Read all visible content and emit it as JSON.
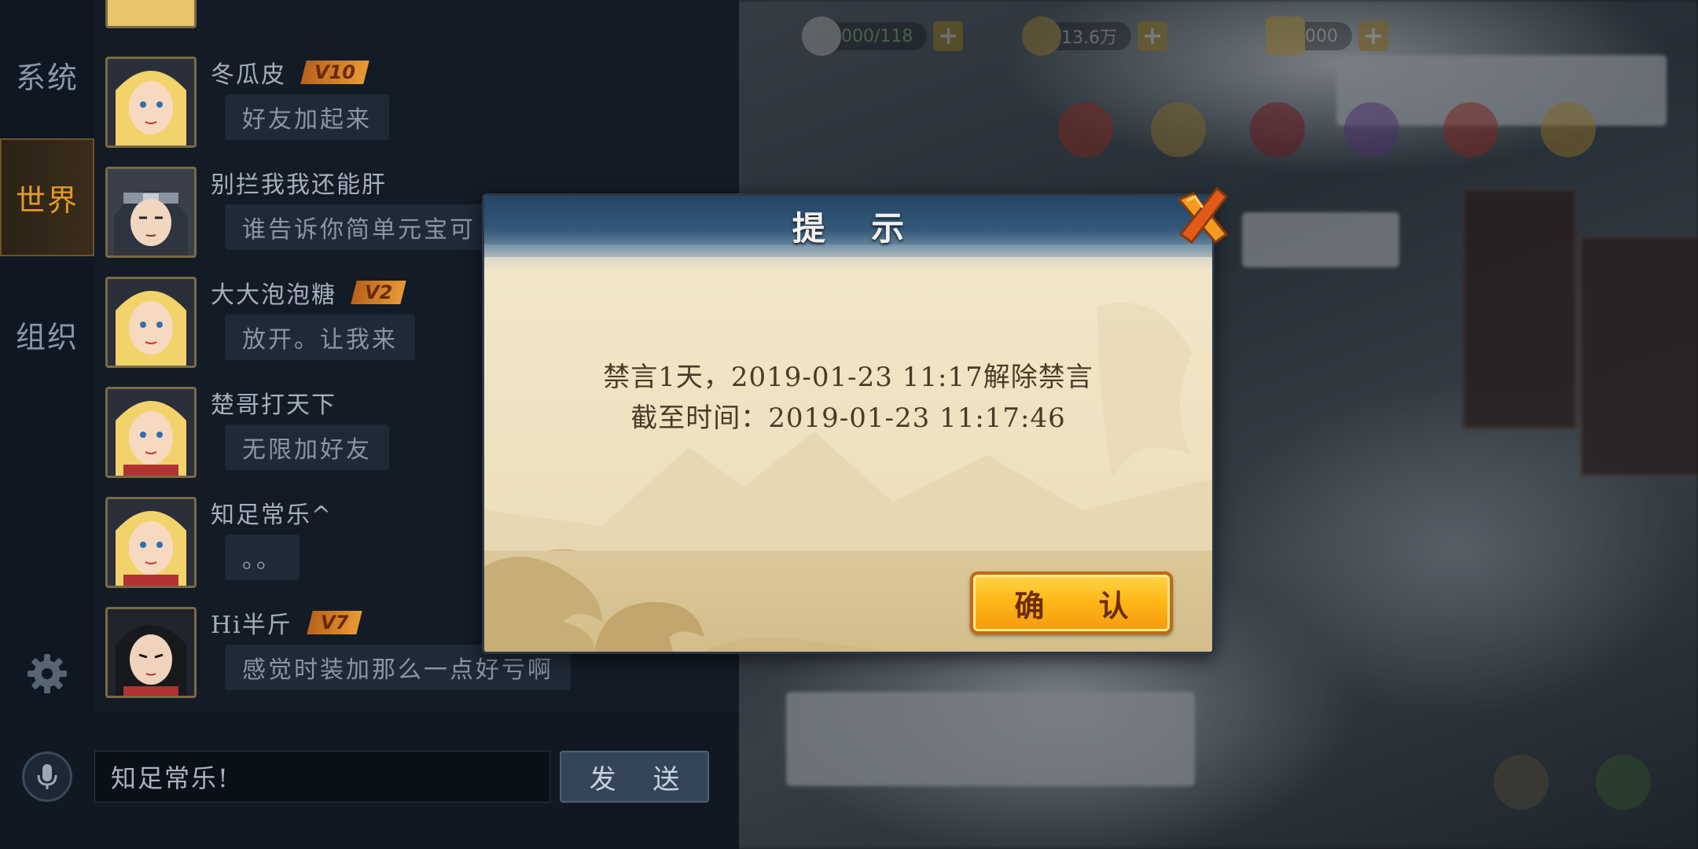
{
  "tabs": [
    {
      "label": "系统",
      "active": false
    },
    {
      "label": "世界",
      "active": true
    },
    {
      "label": "组织",
      "active": false
    }
  ],
  "messages": [
    {
      "name": "冬瓜皮",
      "vip": "V10",
      "text": "好友加起来",
      "avatar": "blonde-girl"
    },
    {
      "name": "别拦我我还能肝",
      "vip": "",
      "text": "谁告诉你简单元宝可",
      "avatar": "ninja-headband"
    },
    {
      "name": "大大泡泡糖",
      "vip": "V2",
      "text": "放开。让我来",
      "avatar": "blonde-girl"
    },
    {
      "name": "楚哥打天下",
      "vip": "",
      "text": "无限加好友",
      "avatar": "blonde-girl"
    },
    {
      "name": "知足常乐^",
      "vip": "",
      "text": "。。",
      "avatar": "blonde-girl"
    },
    {
      "name": "Hi半斤",
      "vip": "V7",
      "text": "感觉时装加那么一点好亏啊",
      "avatar": "dark-hair-girl"
    }
  ],
  "chat_input": {
    "value": "知足常乐!"
  },
  "send_button": {
    "label": "发 送"
  },
  "dialog": {
    "title": "提 示",
    "line1": "禁言1天，2019-01-23 11:17解除禁言",
    "line2": "截至时间：2019-01-23 11:17:46",
    "confirm_label": "确 认"
  },
  "colors": {
    "accent_tab": "#e29a2b",
    "confirm_button": "#ffb81a",
    "dialog_header": "#34587a",
    "dialog_paper": "#efe4c7"
  },
  "icons": [
    "gear-icon",
    "mic-icon",
    "close-icon"
  ]
}
